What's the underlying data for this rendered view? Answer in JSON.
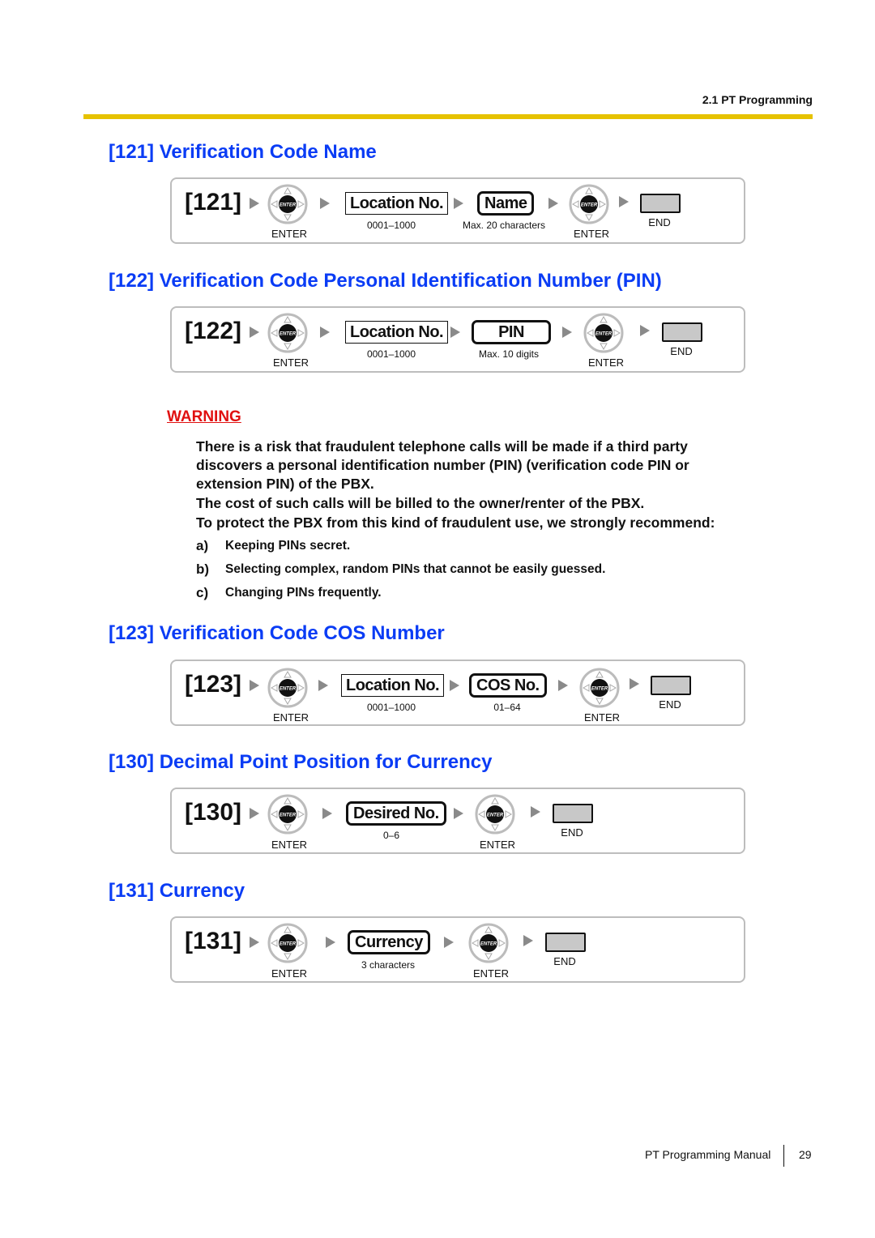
{
  "header": {
    "section": "2.1 PT Programming",
    "accent_color": "#e6c200"
  },
  "title_color": "#0a3cf5",
  "sections": [
    {
      "title": "[121] Verification Code Name",
      "code": "[121]",
      "steps": {
        "enter1": "ENTER",
        "field1": {
          "label": "Location No.",
          "caption": "0001–1000"
        },
        "field2": {
          "label": "Name",
          "caption": "Max. 20 characters"
        },
        "enter2": "ENTER",
        "end": "END"
      }
    },
    {
      "title": "[122] Verification Code Personal Identification Number (PIN)",
      "code": "[122]",
      "steps": {
        "enter1": "ENTER",
        "field1": {
          "label": "Location No.",
          "caption": "0001–1000"
        },
        "field2": {
          "label": "PIN",
          "caption": "Max. 10 digits"
        },
        "enter2": "ENTER",
        "end": "END"
      }
    },
    {
      "title": "[123] Verification Code COS Number",
      "code": "[123]",
      "steps": {
        "enter1": "ENTER",
        "field1": {
          "label": "Location No.",
          "caption": "0001–1000"
        },
        "field2": {
          "label": "COS No.",
          "caption": "01–64"
        },
        "enter2": "ENTER",
        "end": "END"
      }
    },
    {
      "title": "[130] Decimal Point Position for Currency",
      "code": "[130]",
      "steps": {
        "enter1": "ENTER",
        "field1": {
          "label": "Desired No.",
          "caption": "0–6"
        },
        "enter2": "ENTER",
        "end": "END"
      }
    },
    {
      "title": "[131] Currency",
      "code": "[131]",
      "steps": {
        "enter1": "ENTER",
        "field1": {
          "label": "Currency",
          "caption": "3 characters"
        },
        "enter2": "ENTER",
        "end": "END"
      }
    }
  ],
  "warning": {
    "title": "WARNING",
    "color": "#e01010",
    "lines": [
      "There is a risk that fraudulent telephone calls will be made if a third party",
      "discovers a personal identification number (PIN) (verification code PIN or",
      "extension PIN) of the PBX.",
      "The cost of such calls will be billed to the owner/renter of the PBX.",
      "To protect the PBX from this kind of fraudulent use, we strongly recommend:"
    ],
    "items": [
      {
        "label": "a)",
        "text": "Keeping PINs secret."
      },
      {
        "label": "b)",
        "text": "Selecting complex, random PINs that cannot be easily guessed."
      },
      {
        "label": "c)",
        "text": "Changing PINs frequently."
      }
    ]
  },
  "enter_key_glyph": "ENTER",
  "footer": {
    "manual": "PT Programming Manual",
    "page": "29"
  }
}
